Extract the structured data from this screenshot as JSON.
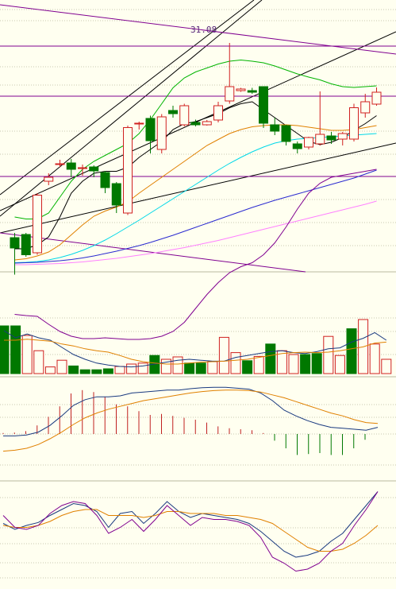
{
  "chart_data": {
    "type": "candlestick",
    "price_annotation": "31.08",
    "candles": [
      {
        "o": 26.18,
        "h": 26.3,
        "l": 25.25,
        "c": 25.92
      },
      {
        "o": 26.26,
        "h": 26.3,
        "l": 25.7,
        "c": 25.75
      },
      {
        "o": 25.8,
        "h": 27.3,
        "l": 25.75,
        "c": 27.25
      },
      {
        "o": 27.6,
        "h": 27.8,
        "l": 27.5,
        "c": 27.7
      },
      {
        "o": 28.02,
        "h": 28.14,
        "l": 27.96,
        "c": 28.04
      },
      {
        "o": 28.06,
        "h": 28.16,
        "l": 27.7,
        "c": 27.9
      },
      {
        "o": 27.94,
        "h": 28.02,
        "l": 27.74,
        "c": 27.94
      },
      {
        "o": 27.96,
        "h": 28.0,
        "l": 27.7,
        "c": 27.86
      },
      {
        "o": 27.82,
        "h": 27.86,
        "l": 27.3,
        "c": 27.44
      },
      {
        "o": 27.54,
        "h": 27.58,
        "l": 26.8,
        "c": 27.0
      },
      {
        "o": 26.8,
        "h": 29.0,
        "l": 26.75,
        "c": 28.95
      },
      {
        "o": 29.04,
        "h": 29.1,
        "l": 28.9,
        "c": 29.06
      },
      {
        "o": 29.18,
        "h": 29.25,
        "l": 28.3,
        "c": 28.62
      },
      {
        "o": 28.4,
        "h": 29.29,
        "l": 28.3,
        "c": 29.22
      },
      {
        "o": 29.38,
        "h": 29.5,
        "l": 29.2,
        "c": 29.3
      },
      {
        "o": 29.02,
        "h": 29.55,
        "l": 28.98,
        "c": 29.5
      },
      {
        "o": 29.08,
        "h": 29.15,
        "l": 28.98,
        "c": 29.02
      },
      {
        "o": 29.02,
        "h": 29.14,
        "l": 29.0,
        "c": 29.1
      },
      {
        "o": 29.14,
        "h": 29.6,
        "l": 29.08,
        "c": 29.5
      },
      {
        "o": 29.62,
        "h": 31.08,
        "l": 29.55,
        "c": 29.98
      },
      {
        "o": 29.88,
        "h": 29.95,
        "l": 29.85,
        "c": 29.92
      },
      {
        "o": 29.88,
        "h": 29.95,
        "l": 29.8,
        "c": 29.84
      },
      {
        "o": 29.98,
        "h": 29.98,
        "l": 28.94,
        "c": 29.06
      },
      {
        "o": 29.02,
        "h": 29.2,
        "l": 28.76,
        "c": 28.86
      },
      {
        "o": 29.0,
        "h": 29.02,
        "l": 28.5,
        "c": 28.6
      },
      {
        "o": 28.54,
        "h": 28.6,
        "l": 28.3,
        "c": 28.42
      },
      {
        "o": 28.46,
        "h": 28.72,
        "l": 28.4,
        "c": 28.7
      },
      {
        "o": 28.54,
        "h": 29.86,
        "l": 28.5,
        "c": 28.78
      },
      {
        "o": 28.74,
        "h": 28.84,
        "l": 28.54,
        "c": 28.64
      },
      {
        "o": 28.66,
        "h": 28.84,
        "l": 28.5,
        "c": 28.8
      },
      {
        "o": 28.66,
        "h": 29.55,
        "l": 28.6,
        "c": 29.45
      },
      {
        "o": 29.32,
        "h": 29.8,
        "l": 29.2,
        "c": 29.6
      },
      {
        "o": 29.54,
        "h": 29.96,
        "l": 29.5,
        "c": 29.84
      }
    ],
    "ma_lines": [
      {
        "color": "#000000",
        "values": [
          25.9,
          25.9,
          26.0,
          26.2,
          26.7,
          27.3,
          27.6,
          27.8,
          27.85,
          27.85,
          27.95,
          28.2,
          28.4,
          28.6,
          28.9,
          29.05,
          29.1,
          29.2,
          29.3,
          29.45,
          29.55,
          29.6,
          29.4,
          29.2,
          29.0,
          28.8,
          28.6,
          28.52,
          28.58,
          28.7,
          28.88,
          29.05,
          29.25
        ]
      },
      {
        "color": "#00b400",
        "values": [
          26.7,
          26.65,
          26.65,
          26.8,
          27.2,
          27.6,
          27.9,
          28.1,
          28.25,
          28.4,
          28.55,
          28.8,
          29.15,
          29.55,
          29.95,
          30.2,
          30.35,
          30.45,
          30.55,
          30.62,
          30.65,
          30.62,
          30.58,
          30.5,
          30.4,
          30.3,
          30.22,
          30.15,
          30.05,
          29.98,
          29.96,
          29.98,
          30.0
        ]
      },
      {
        "color": "#e08000",
        "values": [
          25.62,
          25.65,
          25.72,
          25.82,
          26.0,
          26.25,
          26.5,
          26.72,
          26.85,
          26.95,
          27.08,
          27.3,
          27.5,
          27.7,
          27.9,
          28.1,
          28.3,
          28.5,
          28.65,
          28.8,
          28.9,
          28.97,
          29.0,
          29.02,
          29.02,
          29.0,
          28.96,
          28.92,
          28.88,
          28.88,
          28.9,
          28.95,
          29.0
        ]
      },
      {
        "color": "#00d8e8",
        "values": [
          25.55,
          25.56,
          25.58,
          25.62,
          25.68,
          25.76,
          25.86,
          25.98,
          26.12,
          26.28,
          26.45,
          26.62,
          26.8,
          26.98,
          27.16,
          27.34,
          27.52,
          27.7,
          27.88,
          28.05,
          28.2,
          28.34,
          28.46,
          28.56,
          28.62,
          28.66,
          28.68,
          28.7,
          28.72,
          28.74,
          28.76,
          28.78,
          28.8
        ]
      },
      {
        "color": "#2a2ad0",
        "values": [
          25.54,
          25.55,
          25.56,
          25.58,
          25.6,
          25.63,
          25.67,
          25.72,
          25.78,
          25.84,
          25.91,
          25.98,
          26.06,
          26.15,
          26.24,
          26.34,
          26.44,
          26.54,
          26.64,
          26.74,
          26.84,
          26.94,
          27.03,
          27.12,
          27.2,
          27.28,
          27.36,
          27.44,
          27.52,
          27.6,
          27.68,
          27.78,
          27.88
        ]
      },
      {
        "color": "#ff80ff",
        "values": [
          25.5,
          25.5,
          25.51,
          25.52,
          25.53,
          25.55,
          25.57,
          25.6,
          25.63,
          25.66,
          25.7,
          25.74,
          25.78,
          25.83,
          25.88,
          25.93,
          25.99,
          26.05,
          26.11,
          26.18,
          26.25,
          26.32,
          26.39,
          26.46,
          26.53,
          26.6,
          26.67,
          26.74,
          26.81,
          26.88,
          26.95,
          27.02,
          27.1
        ]
      },
      {
        "color": "#800090",
        "values": [
          24.25,
          24.22,
          24.2,
          24.0,
          23.82,
          23.7,
          23.64,
          23.64,
          23.66,
          23.64,
          23.62,
          23.62,
          23.64,
          23.7,
          23.82,
          24.05,
          24.4,
          24.75,
          25.05,
          25.3,
          25.45,
          25.55,
          25.75,
          26.05,
          26.45,
          26.9,
          27.3,
          27.55,
          27.7,
          27.75,
          27.8,
          27.85,
          27.9
        ]
      }
    ],
    "volume": {
      "ylim": [
        0,
        100
      ],
      "bars": [
        {
          "v": 100,
          "up": false
        },
        {
          "v": 100,
          "up": false
        },
        {
          "v": 80,
          "up": true
        },
        {
          "v": 48,
          "up": true
        },
        {
          "v": 14,
          "up": true
        },
        {
          "v": 28,
          "up": true
        },
        {
          "v": 16,
          "up": false
        },
        {
          "v": 8,
          "up": false
        },
        {
          "v": 8,
          "up": false
        },
        {
          "v": 10,
          "up": false
        },
        {
          "v": 15,
          "up": true
        },
        {
          "v": 20,
          "up": true
        },
        {
          "v": 22,
          "up": true
        },
        {
          "v": 38,
          "up": false
        },
        {
          "v": 30,
          "up": true
        },
        {
          "v": 35,
          "up": true
        },
        {
          "v": 22,
          "up": false
        },
        {
          "v": 22,
          "up": false
        },
        {
          "v": 25,
          "up": true
        },
        {
          "v": 76,
          "up": true
        },
        {
          "v": 44,
          "up": true
        },
        {
          "v": 27,
          "up": false
        },
        {
          "v": 36,
          "up": true
        },
        {
          "v": 62,
          "up": false
        },
        {
          "v": 48,
          "up": true
        },
        {
          "v": 40,
          "up": true
        },
        {
          "v": 40,
          "up": false
        },
        {
          "v": 42,
          "up": false
        },
        {
          "v": 78,
          "up": true
        },
        {
          "v": 38,
          "up": true
        },
        {
          "v": 94,
          "up": false
        },
        {
          "v": 130,
          "up": true
        },
        {
          "v": 62,
          "up": true
        },
        {
          "v": 30,
          "up": true
        }
      ],
      "ma_lines": [
        {
          "color": "#1a3a80",
          "values": [
            90,
            75,
            83,
            75,
            70,
            55,
            40,
            30,
            22,
            18,
            15,
            14,
            16,
            20,
            24,
            28,
            30,
            28,
            26,
            26,
            34,
            38,
            42,
            46,
            48,
            44,
            42,
            46,
            52,
            54,
            66,
            74,
            86,
            70
          ]
        },
        {
          "color": "#e08000",
          "values": [
            70,
            70,
            72,
            70,
            68,
            62,
            58,
            52,
            48,
            45,
            38,
            30,
            25,
            22,
            20,
            20,
            22,
            24,
            25,
            26,
            28,
            30,
            34,
            38,
            42,
            44,
            45,
            44,
            45,
            48,
            52,
            56,
            64,
            66
          ]
        }
      ]
    },
    "macd": {
      "ylim": [
        -1,
        1
      ],
      "hist": [
        0.02,
        0.03,
        0.06,
        0.18,
        0.36,
        0.58,
        0.85,
        0.92,
        0.88,
        0.78,
        0.62,
        0.58,
        0.48,
        0.4,
        0.42,
        0.38,
        0.34,
        0.3,
        0.24,
        0.16,
        0.12,
        0.1,
        0.08,
        0.02,
        -0.14,
        -0.3,
        -0.44,
        -0.42,
        -0.4,
        -0.44,
        -0.44,
        -0.3,
        -0.12
      ],
      "dif": [
        -0.04,
        -0.04,
        -0.02,
        0.04,
        0.18,
        0.38,
        0.6,
        0.72,
        0.78,
        0.78,
        0.8,
        0.86,
        0.88,
        0.9,
        0.92,
        0.92,
        0.95,
        0.97,
        0.98,
        0.98,
        0.96,
        0.94,
        0.86,
        0.7,
        0.5,
        0.38,
        0.28,
        0.2,
        0.14,
        0.12,
        0.1,
        0.08,
        0.14
      ],
      "dea": [
        -0.36,
        -0.34,
        -0.3,
        -0.22,
        -0.1,
        0.04,
        0.2,
        0.34,
        0.44,
        0.52,
        0.58,
        0.64,
        0.7,
        0.74,
        0.78,
        0.82,
        0.86,
        0.89,
        0.91,
        0.92,
        0.92,
        0.91,
        0.88,
        0.82,
        0.76,
        0.68,
        0.6,
        0.52,
        0.44,
        0.38,
        0.3,
        0.24,
        0.22
      ]
    },
    "kdj": {
      "ylim": [
        0,
        100
      ],
      "k": [
        62,
        56,
        60,
        63,
        70,
        76,
        82,
        80,
        74,
        58,
        72,
        74,
        62,
        72,
        84,
        74,
        68,
        72,
        70,
        68,
        66,
        62,
        54,
        44,
        34,
        28,
        30,
        34,
        44,
        52,
        66,
        80,
        94
      ],
      "d": [
        60,
        58,
        58,
        60,
        64,
        70,
        74,
        76,
        76,
        70,
        70,
        70,
        68,
        70,
        74,
        74,
        72,
        72,
        72,
        70,
        70,
        68,
        66,
        62,
        54,
        46,
        38,
        34,
        34,
        36,
        42,
        50,
        60
      ],
      "j": [
        70,
        58,
        56,
        60,
        72,
        80,
        84,
        82,
        70,
        52,
        58,
        66,
        54,
        66,
        80,
        70,
        60,
        68,
        66,
        66,
        64,
        60,
        48,
        28,
        22,
        14,
        16,
        22,
        34,
        42,
        60,
        76,
        94
      ]
    }
  }
}
